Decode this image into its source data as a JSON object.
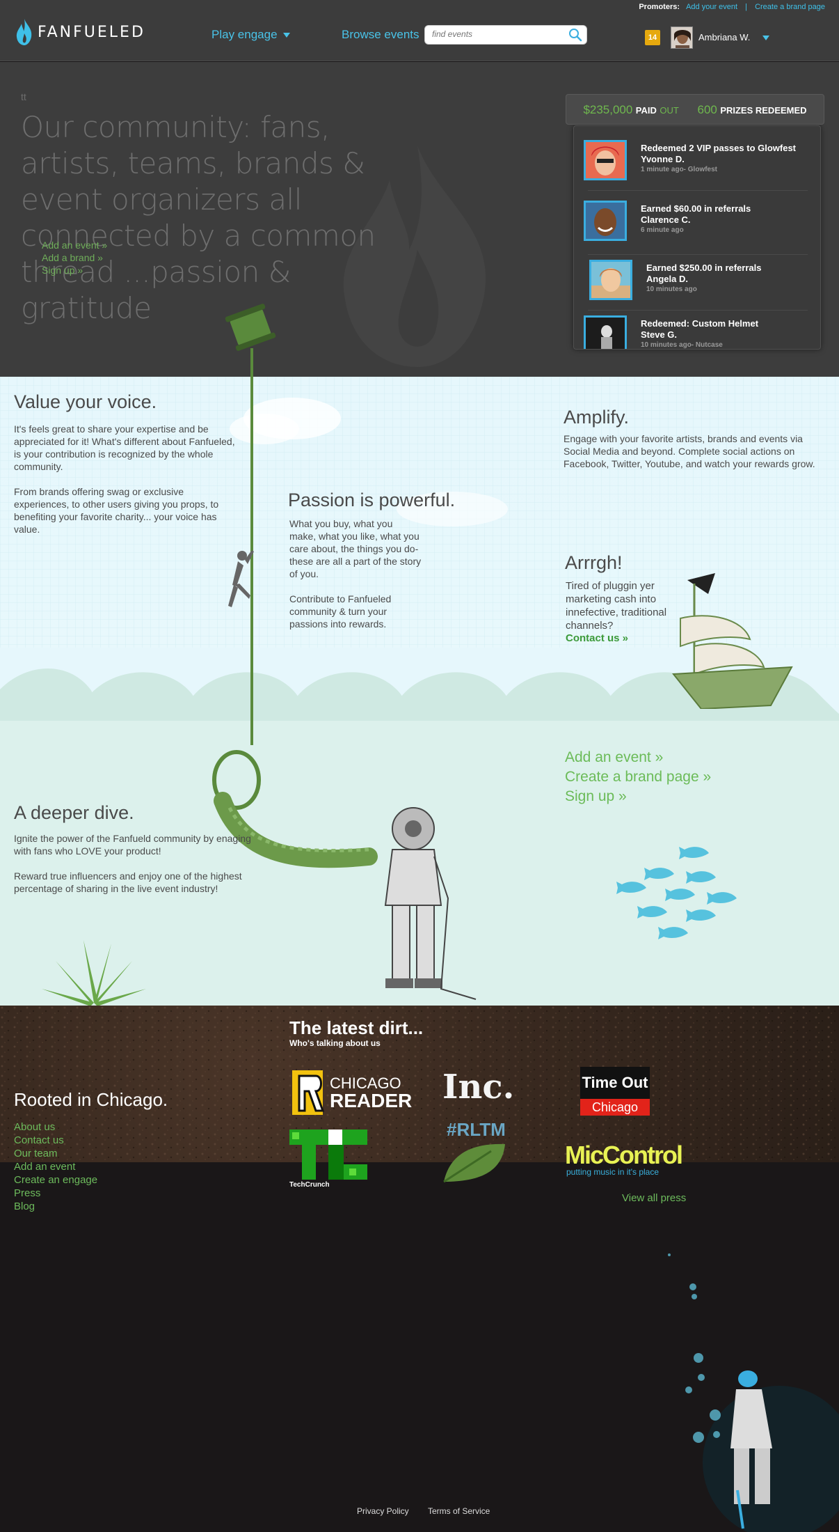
{
  "header": {
    "promoters_label": "Promoters:",
    "add_event": "Add your event",
    "separator": "|",
    "create_brand": "Create a brand page",
    "logo_text": "FANFUELED",
    "nav_play": "Play engage",
    "nav_browse": "Browse events",
    "search_placeholder": "find events",
    "notification_count": "14",
    "user_name": "Ambriana W."
  },
  "hero": {
    "tt": "tt",
    "headline": "Our community:  fans, artists, teams, brands & event organizers all connected by a common thread ...passion & gratitude",
    "links": [
      "Add an event »",
      "Add a brand »",
      "Sign up »"
    ]
  },
  "stats": {
    "paid_amount": "$235,000",
    "paid_label": "PAID",
    "out_label": "OUT",
    "prizes_count": "600",
    "prizes_label": "PRIZES REDEEMED",
    "feed": [
      {
        "line1": "Redeemed 2 VIP passes to Glowfest",
        "line2": "Yvonne D.",
        "meta": "1 minute ago- Glowfest"
      },
      {
        "line1": "Earned $60.00 in referrals",
        "line2": "Clarence C.",
        "meta": "6 minute ago"
      },
      {
        "line1": "Earned $250.00 in referrals",
        "line2": "Angela D.",
        "meta": "10 minutes ago"
      },
      {
        "line1": "Redeemed: Custom Helmet",
        "line2": "Steve G.",
        "meta": "10 minutes ago- Nutcase"
      }
    ]
  },
  "sections": {
    "value_title": "Value your voice.",
    "value_p1": "It's feels great to share your expertise and be appreciated for it! What's different about Fanfueled, is your contribution is recognized by the whole community.",
    "value_p2": "From brands offering swag or exclusive experiences, to other users giving you props, to benefiting your favorite charity... your voice has value.",
    "passion_title": "Passion is powerful.",
    "passion_p1": "What you buy, what you make, what you like, what you care about, the things you do- these are all a part of the story of you.",
    "passion_p2": "Contribute to Fanfueled community & turn your passions into rewards.",
    "amplify_title": "Amplify.",
    "amplify_p": "Engage with your favorite artists, brands and events via Social Media and beyond. Complete social actions on Facebook, Twitter, Youtube, and watch your rewards grow.",
    "arrgh_title": "Arrrgh!",
    "arrgh_p": "Tired of pluggin yer marketing cash into innefective, traditional channels?",
    "arrgh_contact": "Contact us »",
    "big_ctas": [
      "Add an event »",
      "Create a brand page »",
      "Sign up »"
    ],
    "dive_title": "A deeper dive.",
    "dive_p1": "Ignite the power of the Fanfueld community by enaging with fans who LOVE  your product!",
    "dive_p2": "Reward true influencers and enjoy one of the highest percentage of sharing in the live event industry!"
  },
  "dirt": {
    "title": "The latest dirt...",
    "subtitle": "Who's talking about us",
    "rooted_title": "Rooted in Chicago.",
    "rooted_links": [
      "About us",
      "Contact us",
      "Our team",
      "Add an event",
      "Create an engage",
      "Press",
      "Blog"
    ],
    "view_all_press": "View all press",
    "press": {
      "reader_top": "CHICAGO",
      "reader_bottom": "READER",
      "inc": "Inc.",
      "timeout_top": "Time Out",
      "timeout_bottom": "Chicago",
      "techcrunch": "TechCrunch",
      "rltm": "#RLTM",
      "mic": "MicControl",
      "mic_tag": "putting music in it's place"
    }
  },
  "footer": {
    "privacy": "Privacy Policy",
    "terms": "Terms of Service"
  },
  "colors": {
    "accent_blue": "#49c3e8",
    "accent_green": "#6dbb5c",
    "header_bg": "#3c3c3c",
    "sky_bg": "#e6f7fc",
    "sea_bg": "#dcf1ec"
  }
}
